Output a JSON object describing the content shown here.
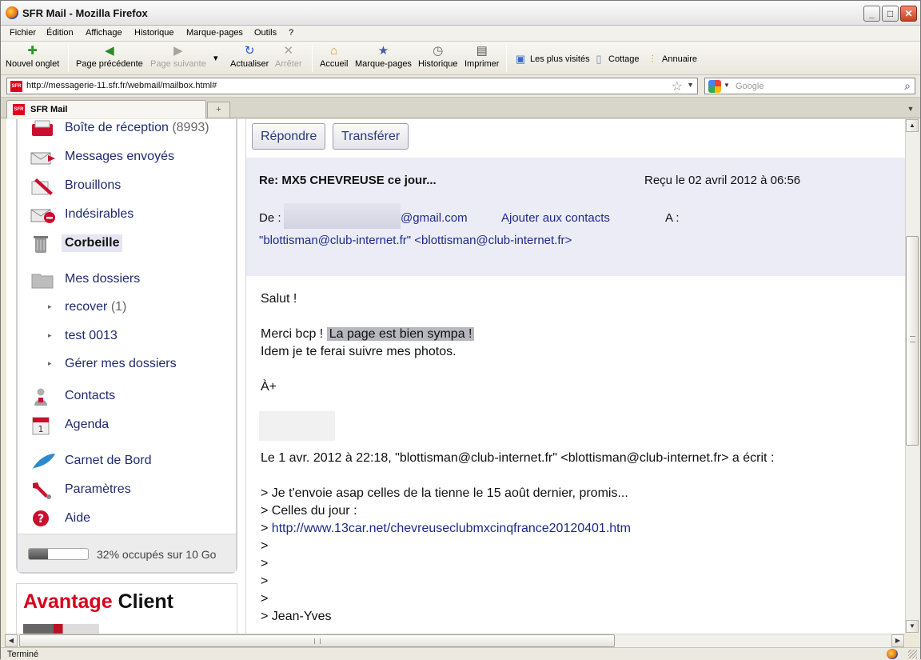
{
  "window": {
    "title": "SFR Mail - Mozilla Firefox"
  },
  "menu": [
    "Fichier",
    "Édition",
    "Affichage",
    "Historique",
    "Marque-pages",
    "Outils",
    "?"
  ],
  "toolbar": {
    "new_tab": "Nouvel onglet",
    "back": "Page précédente",
    "forward": "Page suivante",
    "reload": "Actualiser",
    "stop": "Arrêter",
    "home": "Accueil",
    "bookmarks": "Marque-pages",
    "history": "Historique",
    "print": "Imprimer"
  },
  "bookmarks_bar": [
    "Les plus visités",
    "Cottage",
    "Annuaire"
  ],
  "address": {
    "url": "http://messagerie-11.sfr.fr/webmail/mailbox.html#",
    "search_placeholder": "Google"
  },
  "favicon_label": "SFR",
  "tab": {
    "title": "SFR Mail"
  },
  "sidebar": {
    "folders": [
      {
        "label": "Boîte de réception",
        "count": "(8993)"
      },
      {
        "label": "Messages envoyés",
        "count": ""
      },
      {
        "label": "Brouillons",
        "count": ""
      },
      {
        "label": "Indésirables",
        "count": ""
      },
      {
        "label": "Corbeille",
        "count": ""
      },
      {
        "label": "Mes dossiers",
        "count": ""
      }
    ],
    "subfolders": [
      {
        "label": "recover",
        "count": "(1)"
      },
      {
        "label": "test 0013",
        "count": ""
      },
      {
        "label": "Gérer mes dossiers",
        "count": ""
      }
    ],
    "tools": [
      "Contacts",
      "Agenda",
      "Carnet de Bord",
      "Paramètres",
      "Aide"
    ],
    "quota": {
      "text": "32% occupés sur 10 Go",
      "fraction": 0.32
    },
    "promo": {
      "red": "Avantage",
      "dark": "Client"
    }
  },
  "message": {
    "reply": "Répondre",
    "forward": "Transférer",
    "subject": "Re: MX5 CHEVREUSE ce jour...",
    "received": "Reçu le 02 avril 2012 à 06:56",
    "from_label": "De :",
    "from_domain": "@gmail.com",
    "add_contact": "Ajouter aux contacts",
    "to_label": "A :",
    "to": "\"blottisman@club-internet.fr\" <blottisman@club-internet.fr>",
    "body": {
      "greeting": "Salut !",
      "line1_a": "Merci bcp !",
      "line1_hl": "La page est bien sympa !",
      "line2": "Idem je te ferai suivre mes photos.",
      "signoff": "À+",
      "quote_header": "Le 1 avr. 2012 à 22:18, \"blottisman@club-internet.fr\" <blottisman@club-internet.fr> a écrit :",
      "quote1": "> Je t'envoie asap celles de la tienne le 15 août dernier, promis...",
      "quote2": "> Celles du jour :",
      "quote_link_prefix": ">",
      "quote_link": "http://www.13car.net/chevreuseclubmxcinqfrance20120401.htm",
      "quote_empty": ">",
      "quote_name": "> Jean-Yves"
    }
  },
  "status": {
    "text": "Terminé"
  }
}
